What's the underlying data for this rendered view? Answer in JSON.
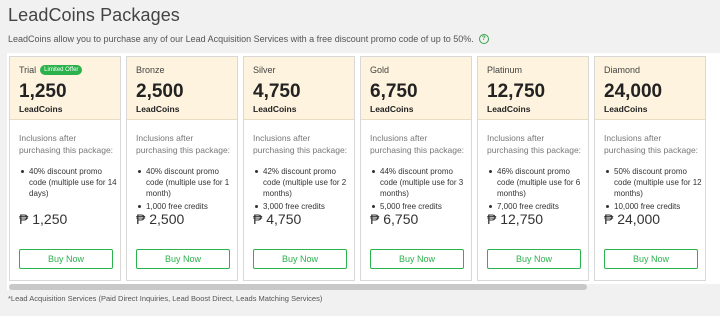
{
  "header": {
    "title": "LeadCoins Packages",
    "subtitle": "LeadCoins allow you to purchase any of our Lead Acquisition Services with a free discount promo code of up to 50%.",
    "help_icon": "question-circle-icon"
  },
  "colors": {
    "accent_green": "#2bb24c",
    "card_header_bg": "#fdf3de"
  },
  "packages": [
    {
      "tier": "Trial",
      "badge": "Limited Offer",
      "amount": "1,250",
      "unit": "LeadCoins",
      "inclusions_label": "Inclusions after purchasing this package:",
      "perks": [
        "40% discount promo code (multiple use for 14 days)"
      ],
      "price": "₱ 1,250",
      "button": "Buy Now"
    },
    {
      "tier": "Bronze",
      "amount": "2,500",
      "unit": "LeadCoins",
      "inclusions_label": "Inclusions after purchasing this package:",
      "perks": [
        "40% discount promo code (multiple use for 1 month)",
        "1,000 free credits"
      ],
      "price": "₱ 2,500",
      "button": "Buy Now"
    },
    {
      "tier": "Silver",
      "amount": "4,750",
      "unit": "LeadCoins",
      "inclusions_label": "Inclusions after purchasing this package:",
      "perks": [
        "42% discount promo code (multiple use for 2 months)",
        "3,000 free credits"
      ],
      "price": "₱ 4,750",
      "button": "Buy Now"
    },
    {
      "tier": "Gold",
      "amount": "6,750",
      "unit": "LeadCoins",
      "inclusions_label": "Inclusions after purchasing this package:",
      "perks": [
        "44% discount promo code (multiple use for 3 months)",
        "5,000 free credits"
      ],
      "price": "₱ 6,750",
      "button": "Buy Now"
    },
    {
      "tier": "Platinum",
      "amount": "12,750",
      "unit": "LeadCoins",
      "inclusions_label": "Inclusions after purchasing this package:",
      "perks": [
        "46% discount promo code (multiple use for 6 months)",
        "7,000 free credits"
      ],
      "price": "₱ 12,750",
      "button": "Buy Now"
    },
    {
      "tier": "Diamond",
      "amount": "24,000",
      "unit": "LeadCoins",
      "inclusions_label": "Inclusions after purchasing this package:",
      "perks": [
        "50% discount promo code (multiple use for 12 months)",
        "10,000 free credits"
      ],
      "price": "₱ 24,000",
      "button": "Buy Now"
    }
  ],
  "footnote": "*Lead Acquisition Services (Paid Direct Inquiries, Lead Boost Direct, Leads Matching Services)"
}
